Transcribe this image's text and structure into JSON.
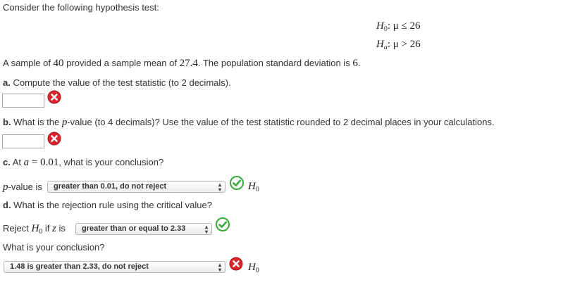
{
  "intro": "Consider the following hypothesis test:",
  "hypotheses": {
    "h0_label": "H",
    "h0_sub": "0",
    "h0_rel": ": μ ≤ 26",
    "ha_label": "H",
    "ha_sub": "a",
    "ha_rel": ": μ > 26"
  },
  "sample_sentence": {
    "p1": "A sample of ",
    "n": "40",
    "p2": " provided a sample mean of ",
    "mean": "27.4",
    "p3": ". The population standard deviation is ",
    "sd": "6",
    "p4": "."
  },
  "part_a": {
    "label": "a.",
    "text": " Compute the value of the test statistic (to 2 decimals).",
    "value": "",
    "status": "incorrect"
  },
  "part_b": {
    "label": "b.",
    "t1": " What is the ",
    "p": "p",
    "t2": "-value (to 4 decimals)? Use the value of the test statistic rounded to 2 decimal places in your calculations.",
    "value": "",
    "status": "incorrect"
  },
  "part_c": {
    "label": "c.",
    "t1": " At ",
    "a": "a",
    "eq": " = ",
    "alpha": "0.01",
    "t2": ", what is your conclusion?",
    "p": "p",
    "pvalue_is": "-value is",
    "selected": "greater than 0.01, do not reject",
    "status": "correct",
    "h_label": "H",
    "h_sub": "0"
  },
  "part_d": {
    "label": "d.",
    "text": " What is the rejection rule using the critical value?",
    "reject": "Reject ",
    "h_label": "H",
    "h_sub": "0",
    "if": " if ",
    "z": "z",
    "is": " is",
    "selected": "greater than or equal to 2.33",
    "status": "correct"
  },
  "conclusion": {
    "question": "What is your conclusion?",
    "selected": "1.48 is greater than 2.33, do not reject",
    "status": "incorrect",
    "h_label": "H",
    "h_sub": "0"
  },
  "colors": {
    "correct": "#3aa83a",
    "incorrect": "#d9252b"
  }
}
